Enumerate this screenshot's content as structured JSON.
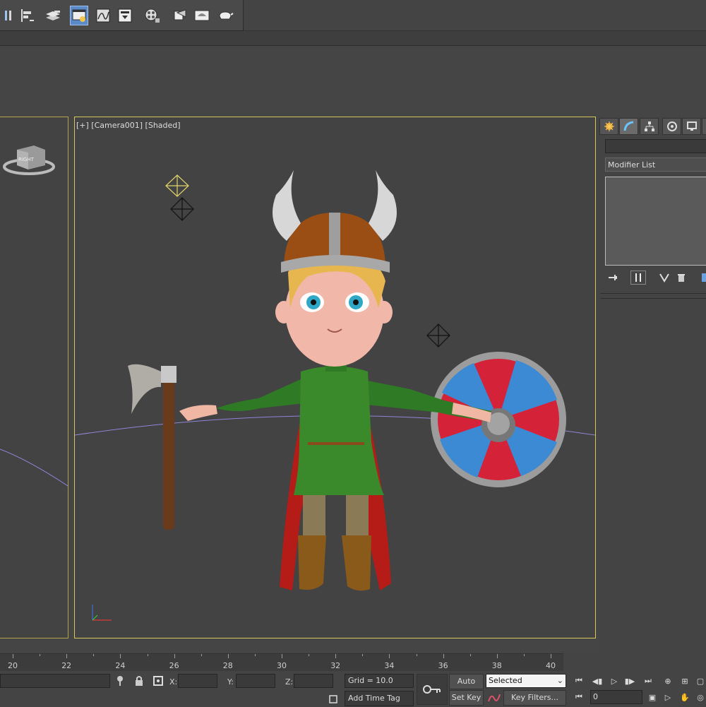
{
  "toolbar": {
    "buttons": [
      {
        "name": "mirror-icon"
      },
      {
        "name": "align-icon"
      },
      {
        "name": "layer-manager-icon"
      },
      {
        "name": "toggle-scene-explorer-icon",
        "active": true
      },
      {
        "name": "curve-editor-icon"
      },
      {
        "name": "schematic-view-icon"
      },
      {
        "name": "material-editor-icon"
      },
      {
        "name": "render-setup-icon"
      },
      {
        "name": "rendered-frame-window-icon"
      },
      {
        "name": "render-production-icon"
      }
    ]
  },
  "viewport": {
    "label": "[+] [Camera001] [Shaded]",
    "left_preview_cube_text": "RIGHT"
  },
  "command_panel": {
    "tabs": [
      "create-tab-icon",
      "modify-tab-icon",
      "hierarchy-tab-icon",
      "motion-tab-icon",
      "display-tab-icon",
      "utilities-tab-icon"
    ],
    "name_value": "",
    "modifier_list": "Modifier List",
    "stack_tools": [
      "pin-stack-icon",
      "show-end-result-icon",
      "make-unique-icon",
      "remove-modifier-icon",
      "configure-modifier-sets-icon"
    ]
  },
  "timeline": {
    "ticks": [
      "20",
      "22",
      "24",
      "26",
      "28",
      "30",
      "32",
      "34",
      "36",
      "38",
      "40"
    ]
  },
  "status": {
    "x_label": "X:",
    "y_label": "Y:",
    "z_label": "Z:",
    "x_value": "",
    "y_value": "",
    "z_value": "",
    "grid": "Grid = 10.0",
    "add_time_tag": "Add Time Tag",
    "auto_key": "Auto Key",
    "set_key": "Set Key",
    "selected": "Selected",
    "key_filters": "Key Filters...",
    "frame": "0"
  }
}
